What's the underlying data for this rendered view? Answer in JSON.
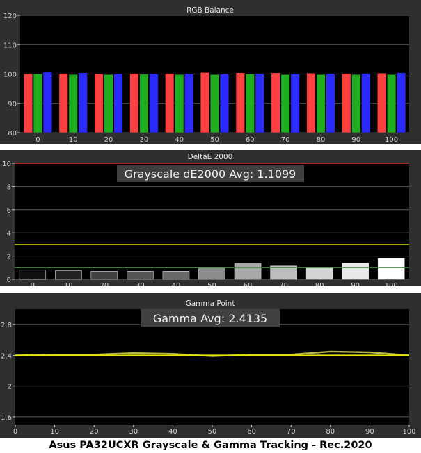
{
  "caption": "Asus PA32UCXR Grayscale & Gamma Tracking - Rec.2020",
  "chart_data": [
    {
      "type": "bar",
      "title": "RGB Balance",
      "categories": [
        "0",
        "10",
        "20",
        "30",
        "40",
        "50",
        "60",
        "70",
        "80",
        "90",
        "100"
      ],
      "ylim": [
        80,
        120
      ],
      "yticks": [
        80,
        90,
        100,
        110,
        120
      ],
      "grid": true,
      "series": [
        {
          "name": "",
          "color": "#ff4040",
          "values": [
            100.2,
            100.2,
            100.1,
            100.2,
            100.2,
            100.5,
            100.4,
            100.4,
            100.3,
            100.2,
            100.3
          ]
        },
        {
          "name": "",
          "color": "#1fae1f",
          "values": [
            100.0,
            99.8,
            99.8,
            99.9,
            99.8,
            99.8,
            100.0,
            99.8,
            99.8,
            99.8,
            99.8
          ]
        },
        {
          "name": "",
          "color": "#2b2bff",
          "values": [
            100.6,
            100.4,
            100.1,
            100.1,
            100.1,
            100.0,
            100.2,
            100.2,
            100.2,
            100.2,
            100.4
          ]
        }
      ]
    },
    {
      "type": "bar",
      "title": "DeltaE 2000",
      "annotation": "Grayscale dE2000 Avg: 1.1099",
      "categories": [
        "0",
        "10",
        "20",
        "30",
        "40",
        "50",
        "60",
        "70",
        "80",
        "90",
        "100"
      ],
      "ylim": [
        0,
        10
      ],
      "yticks": [
        0,
        2,
        4,
        6,
        8,
        10
      ],
      "grid": true,
      "values": [
        0.8,
        0.75,
        0.7,
        0.7,
        0.7,
        1.0,
        1.4,
        1.15,
        1.0,
        1.4,
        1.8
      ],
      "bar_colors": [
        "#111111",
        "#222222",
        "#404040",
        "#555555",
        "#696969",
        "#8c8c8c",
        "#a8a8a8",
        "#bdbdbd",
        "#d4d4d4",
        "#e8e8e8",
        "#ffffff"
      ],
      "reference_lines": [
        {
          "value": 1,
          "color": "#2f9a2f"
        },
        {
          "value": 3,
          "color": "#d8d800"
        },
        {
          "value": 10,
          "color": "#ff4040"
        }
      ]
    },
    {
      "type": "line",
      "title": "Gamma Point",
      "annotation": "Gamma Avg: 2.4135",
      "xlim": [
        0,
        100
      ],
      "xticks": [
        0,
        10,
        20,
        30,
        40,
        50,
        60,
        70,
        80,
        90,
        100
      ],
      "ylim": [
        1.5,
        3.0
      ],
      "yticks": [
        1.6,
        2,
        2.4,
        2.8
      ],
      "grid": true,
      "series": [
        {
          "name": "",
          "color": "#b8b84a",
          "x": [
            0,
            10,
            20,
            30,
            40,
            50,
            60,
            70,
            80,
            90,
            100
          ],
          "y": [
            2.4,
            2.41,
            2.41,
            2.43,
            2.42,
            2.39,
            2.41,
            2.41,
            2.45,
            2.44,
            2.4
          ]
        },
        {
          "name": "",
          "color": "#e6e600",
          "x": [
            0,
            100
          ],
          "y": [
            2.4,
            2.4
          ]
        }
      ]
    }
  ]
}
